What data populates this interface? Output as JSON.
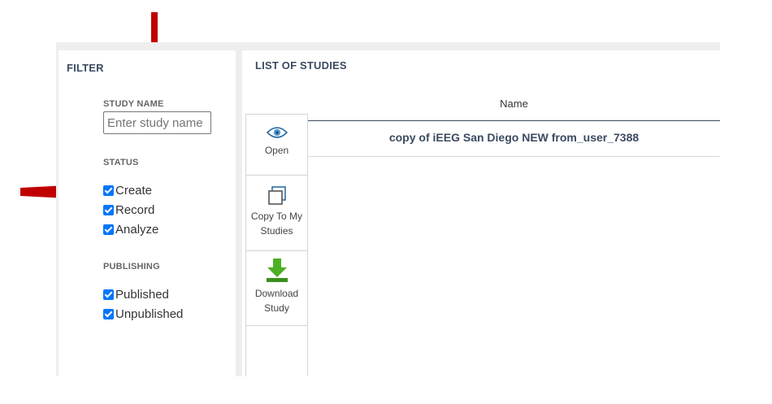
{
  "filter": {
    "title": "FILTER",
    "study_name": {
      "label": "STUDY NAME",
      "placeholder": "Enter study name",
      "value": ""
    },
    "status": {
      "label": "STATUS",
      "options": [
        {
          "label": "Create",
          "checked": true
        },
        {
          "label": "Record",
          "checked": true
        },
        {
          "label": "Analyze",
          "checked": true
        }
      ]
    },
    "publishing": {
      "label": "PUBLISHING",
      "options": [
        {
          "label": "Published",
          "checked": true
        },
        {
          "label": "Unpublished",
          "checked": true
        }
      ]
    }
  },
  "studies": {
    "title": "LIST OF STUDIES",
    "actions": [
      {
        "label": "Open",
        "icon": "eye-icon"
      },
      {
        "label": "Copy To My Studies",
        "icon": "copy-icon"
      },
      {
        "label": "Download Study",
        "icon": "download-icon"
      }
    ],
    "columns": [
      "Name"
    ],
    "rows": [
      {
        "name": "copy of iEEG San Diego NEW from_user_7388"
      }
    ]
  },
  "colors": {
    "annotation_arrow": "#c00000",
    "heading": "#3b4a60",
    "checkbox": "#0075ff",
    "icon_blue": "#2e6da4",
    "download_green": "#4caf24",
    "panel_background": "#eeeeee"
  }
}
